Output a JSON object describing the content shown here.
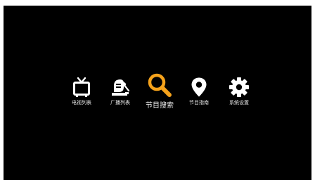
{
  "menu": {
    "items": [
      {
        "label": "电视列表",
        "icon": "tv-icon",
        "selected": false
      },
      {
        "label": "广播列表",
        "icon": "radio-icon",
        "selected": false
      },
      {
        "label": "节目搜索",
        "icon": "search-icon",
        "selected": true
      },
      {
        "label": "节目指南",
        "icon": "location-pin-icon",
        "selected": false
      },
      {
        "label": "系统设置",
        "icon": "gear-icon",
        "selected": false
      }
    ]
  },
  "colors": {
    "background": "#000000",
    "icon": "#ffffff",
    "selected_icon": "#f5a21b",
    "label": "#e8e8e8"
  }
}
